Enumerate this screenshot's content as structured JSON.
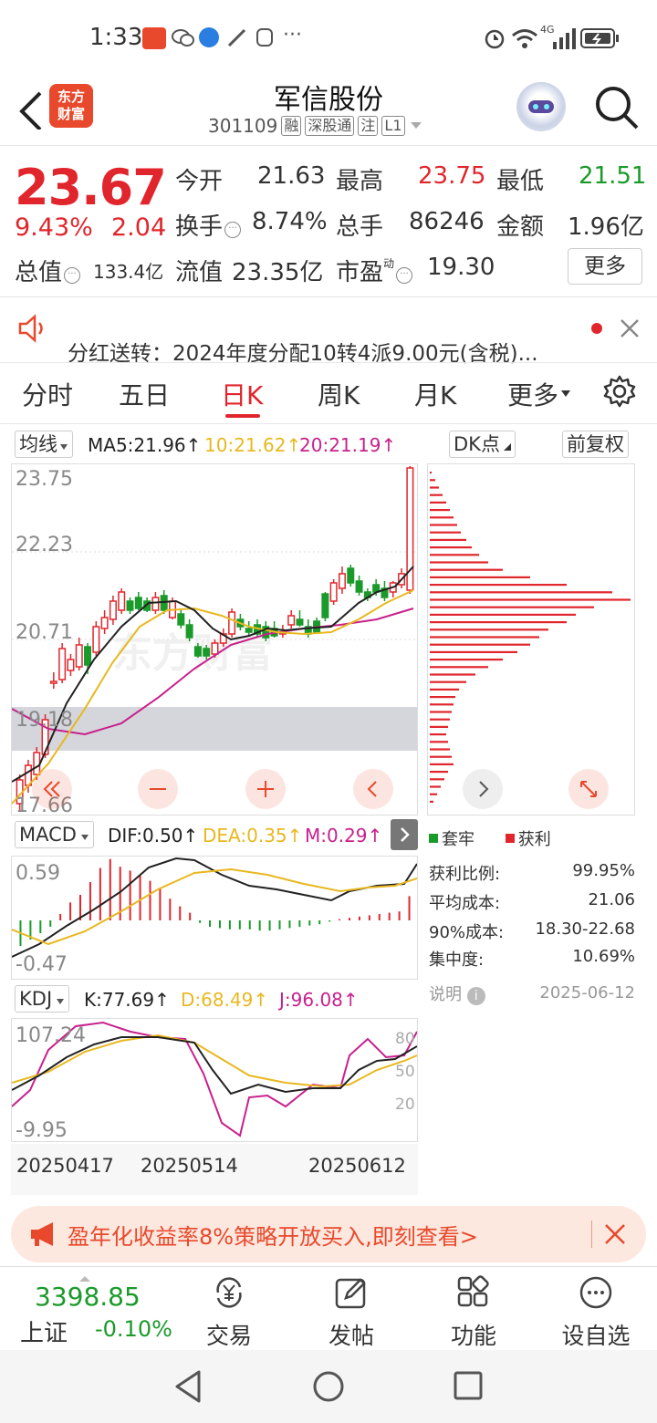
{
  "status_bar": {
    "time": "1:33",
    "network": "4G"
  },
  "header": {
    "logo_line1": "东方",
    "logo_line2": "财富",
    "stock_name": "军信股份",
    "stock_code": "301109",
    "tags": [
      "融",
      "深股通",
      "注",
      "L1"
    ]
  },
  "quote": {
    "price": "23.67",
    "change_pct": "9.43%",
    "change_amt": "2.04",
    "open_label": "今开",
    "open": "21.63",
    "high_label": "最高",
    "high": "23.75",
    "low_label": "最低",
    "low": "21.51",
    "turnover_label": "换手",
    "turnover": "8.74%",
    "volume_label": "总手",
    "volume": "86246",
    "amount_label": "金额",
    "amount": "1.96亿",
    "mcap_label": "总值",
    "mcap": "133.4亿",
    "float_label": "流值",
    "float_mcap": "23.35亿",
    "pe_label": "市盈",
    "pe_sup": "动",
    "pe": "19.30",
    "more_label": "更多"
  },
  "notice": {
    "text": "分红送转：2024年度分配10转4派9.00元(含税)..."
  },
  "tabs": [
    "分时",
    "五日",
    "日K",
    "周K",
    "月K",
    "更多"
  ],
  "active_tab": "日K",
  "ma_legend": {
    "selector": "均线",
    "ma5": "MA5:21.96↑",
    "ma10": "10:21.62↑",
    "ma20": "20:21.19↑",
    "dk_label": "DK点",
    "adjust_label": "前复权"
  },
  "colors": {
    "up": "#e0262c",
    "down": "#1a9a2a",
    "ma5": "#222222",
    "ma10": "#e8b820",
    "ma20": "#c8208c",
    "brand": "#e8482b"
  },
  "kline_axis": {
    "top": "23.75",
    "mid1": "22.23",
    "mid2": "20.71",
    "mid3": "19.18",
    "bottom": "17.66"
  },
  "macd_legend": {
    "selector": "MACD",
    "dif": "DIF:0.50↑",
    "dea": "DEA:0.35↑",
    "m": "M:0.29↑"
  },
  "macd_axis": {
    "top": "0.59",
    "bottom": "-0.47"
  },
  "kdj_legend": {
    "selector": "KDJ",
    "k": "K:77.69↑",
    "d": "D:68.49↑",
    "j": "J:96.08↑"
  },
  "kdj_axis": {
    "top": "107.24",
    "bottom": "-9.95",
    "l80": "80",
    "l50": "50",
    "l20": "20"
  },
  "dates": [
    "20250417",
    "20250514",
    "20250612"
  ],
  "profile": {
    "legend_trapped": "套牢",
    "legend_profit": "获利",
    "rows": [
      {
        "label": "获利比例:",
        "value": "99.95%"
      },
      {
        "label": "平均成本:",
        "value": "21.06"
      },
      {
        "label": "90%成本:",
        "value": "18.30-22.68"
      },
      {
        "label": "集中度:",
        "value": "10.69%"
      }
    ],
    "note_label": "说明",
    "date": "2025-06-12"
  },
  "ad": {
    "text": "盈年化收益率8%策略开放买入,即刻查看>"
  },
  "bottom_bar": {
    "index_value": "3398.85",
    "index_name": "上证",
    "index_change": "-0.10%",
    "items": [
      "交易",
      "发帖",
      "功能",
      "设自选"
    ]
  }
}
